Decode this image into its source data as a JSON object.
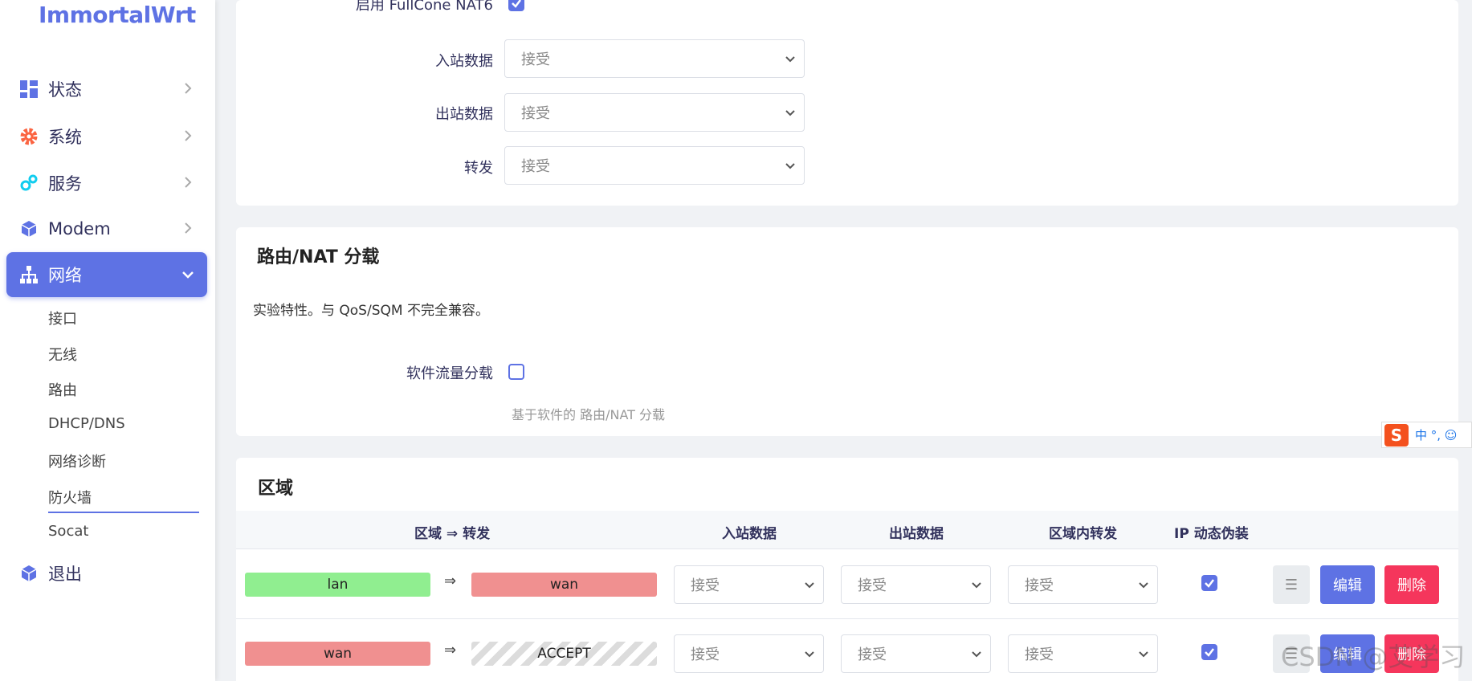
{
  "brand": {
    "name": "ImmortalWrt"
  },
  "sidebar": {
    "items": [
      {
        "label": "状态",
        "icon": "dashboard-icon"
      },
      {
        "label": "系统",
        "icon": "gear-icon"
      },
      {
        "label": "服务",
        "icon": "cogs-icon"
      },
      {
        "label": "Modem",
        "icon": "cube-icon"
      },
      {
        "label": "网络",
        "icon": "network-icon"
      },
      {
        "label": "退出",
        "icon": "cube-icon"
      }
    ],
    "submenu": [
      "接口",
      "无线",
      "路由",
      "DHCP/DNS",
      "网络诊断",
      "防火墙",
      "Socat"
    ],
    "active_item": "网络",
    "active_submenu": "防火墙"
  },
  "general": {
    "fullcone_label": "启用 FullCone NAT6",
    "fullcone_checked": true,
    "input_label": "入站数据",
    "input_value": "接受",
    "output_label": "出站数据",
    "output_value": "接受",
    "forward_label": "转发",
    "forward_value": "接受"
  },
  "offload": {
    "title": "路由/NAT 分载",
    "description": "实验特性。与 QoS/SQM 不完全兼容。",
    "sw_label": "软件流量分载",
    "sw_checked": false,
    "sw_hint": "基于软件的 路由/NAT 分载"
  },
  "zones": {
    "title": "区域",
    "headers": [
      "区域 ⇒ 转发",
      "入站数据",
      "出站数据",
      "区域内转发",
      "IP 动态伪装"
    ],
    "arrow": "⇒",
    "drag_symbol": "☰",
    "edit_label": "编辑",
    "delete_label": "删除",
    "rows": [
      {
        "zone": "lan",
        "zone_color": "#90ee90",
        "forward": "wan",
        "forward_color": "#f09090",
        "input": "接受",
        "output": "接受",
        "intra": "接受",
        "masq": true
      },
      {
        "zone": "wan",
        "zone_color": "#f09090",
        "forward": "ACCEPT",
        "forward_color": "striped",
        "input": "接受",
        "output": "接受",
        "intra": "接受",
        "masq": true
      }
    ]
  },
  "ime": {
    "label": "中 °, ☺"
  },
  "watermark": "CSDN @艾学习",
  "colors": {
    "accent": "#5e72e4",
    "danger": "#f5365c",
    "lan": "#90ee90",
    "wan": "#f09090"
  }
}
